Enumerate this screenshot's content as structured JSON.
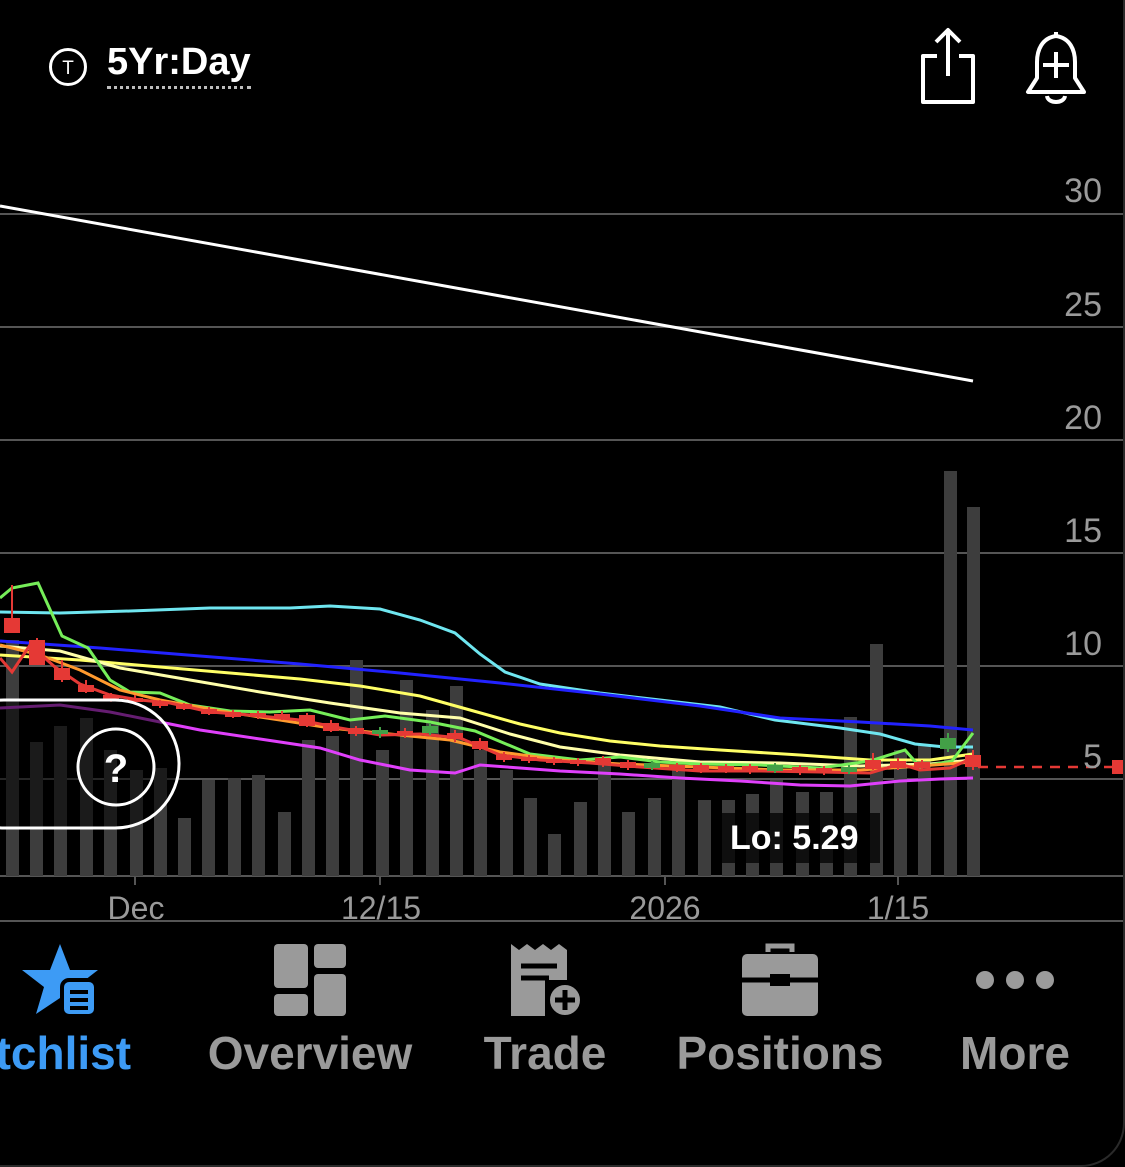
{
  "header": {
    "symbol_icon": "t-circle-icon",
    "period_label": "5Yr:Day",
    "share_icon": "share-icon",
    "alert_icon": "bell-plus-icon"
  },
  "chart": {
    "y_ticks": [
      "30",
      "25",
      "20",
      "15",
      "10",
      "5"
    ],
    "x_ticks": [
      "Dec",
      "12/15",
      "2026",
      "1/15"
    ],
    "low_label": "Lo: 5.29",
    "help_label": "?",
    "colors": {
      "grid": "#555555",
      "volume": "#3d3d3d",
      "candle_down": "#e53935",
      "candle_up": "#43a047",
      "trendline": "#ffffff",
      "ma_green": "#76ee59",
      "ma_cyan": "#6fe6f0",
      "ma_blue": "#1a1aff",
      "ma_yellow": "#ffff66",
      "ma_lightyellow": "#ffffaa",
      "ma_orange": "#ff9a2e",
      "ma_magenta": "#e040fb",
      "price_line": "#e53935"
    }
  },
  "tabs": [
    {
      "label": "atchlist",
      "icon": "star-list-icon",
      "active": true
    },
    {
      "label": "Overview",
      "icon": "dashboard-grid-icon",
      "active": false
    },
    {
      "label": "Trade",
      "icon": "receipt-plus-icon",
      "active": false
    },
    {
      "label": "Positions",
      "icon": "briefcase-icon",
      "active": false
    },
    {
      "label": "More",
      "icon": "ellipsis-icon",
      "active": false
    }
  ],
  "tab_colors": {
    "active": "#3d9bf5",
    "inactive": "#9a9a9a"
  }
}
